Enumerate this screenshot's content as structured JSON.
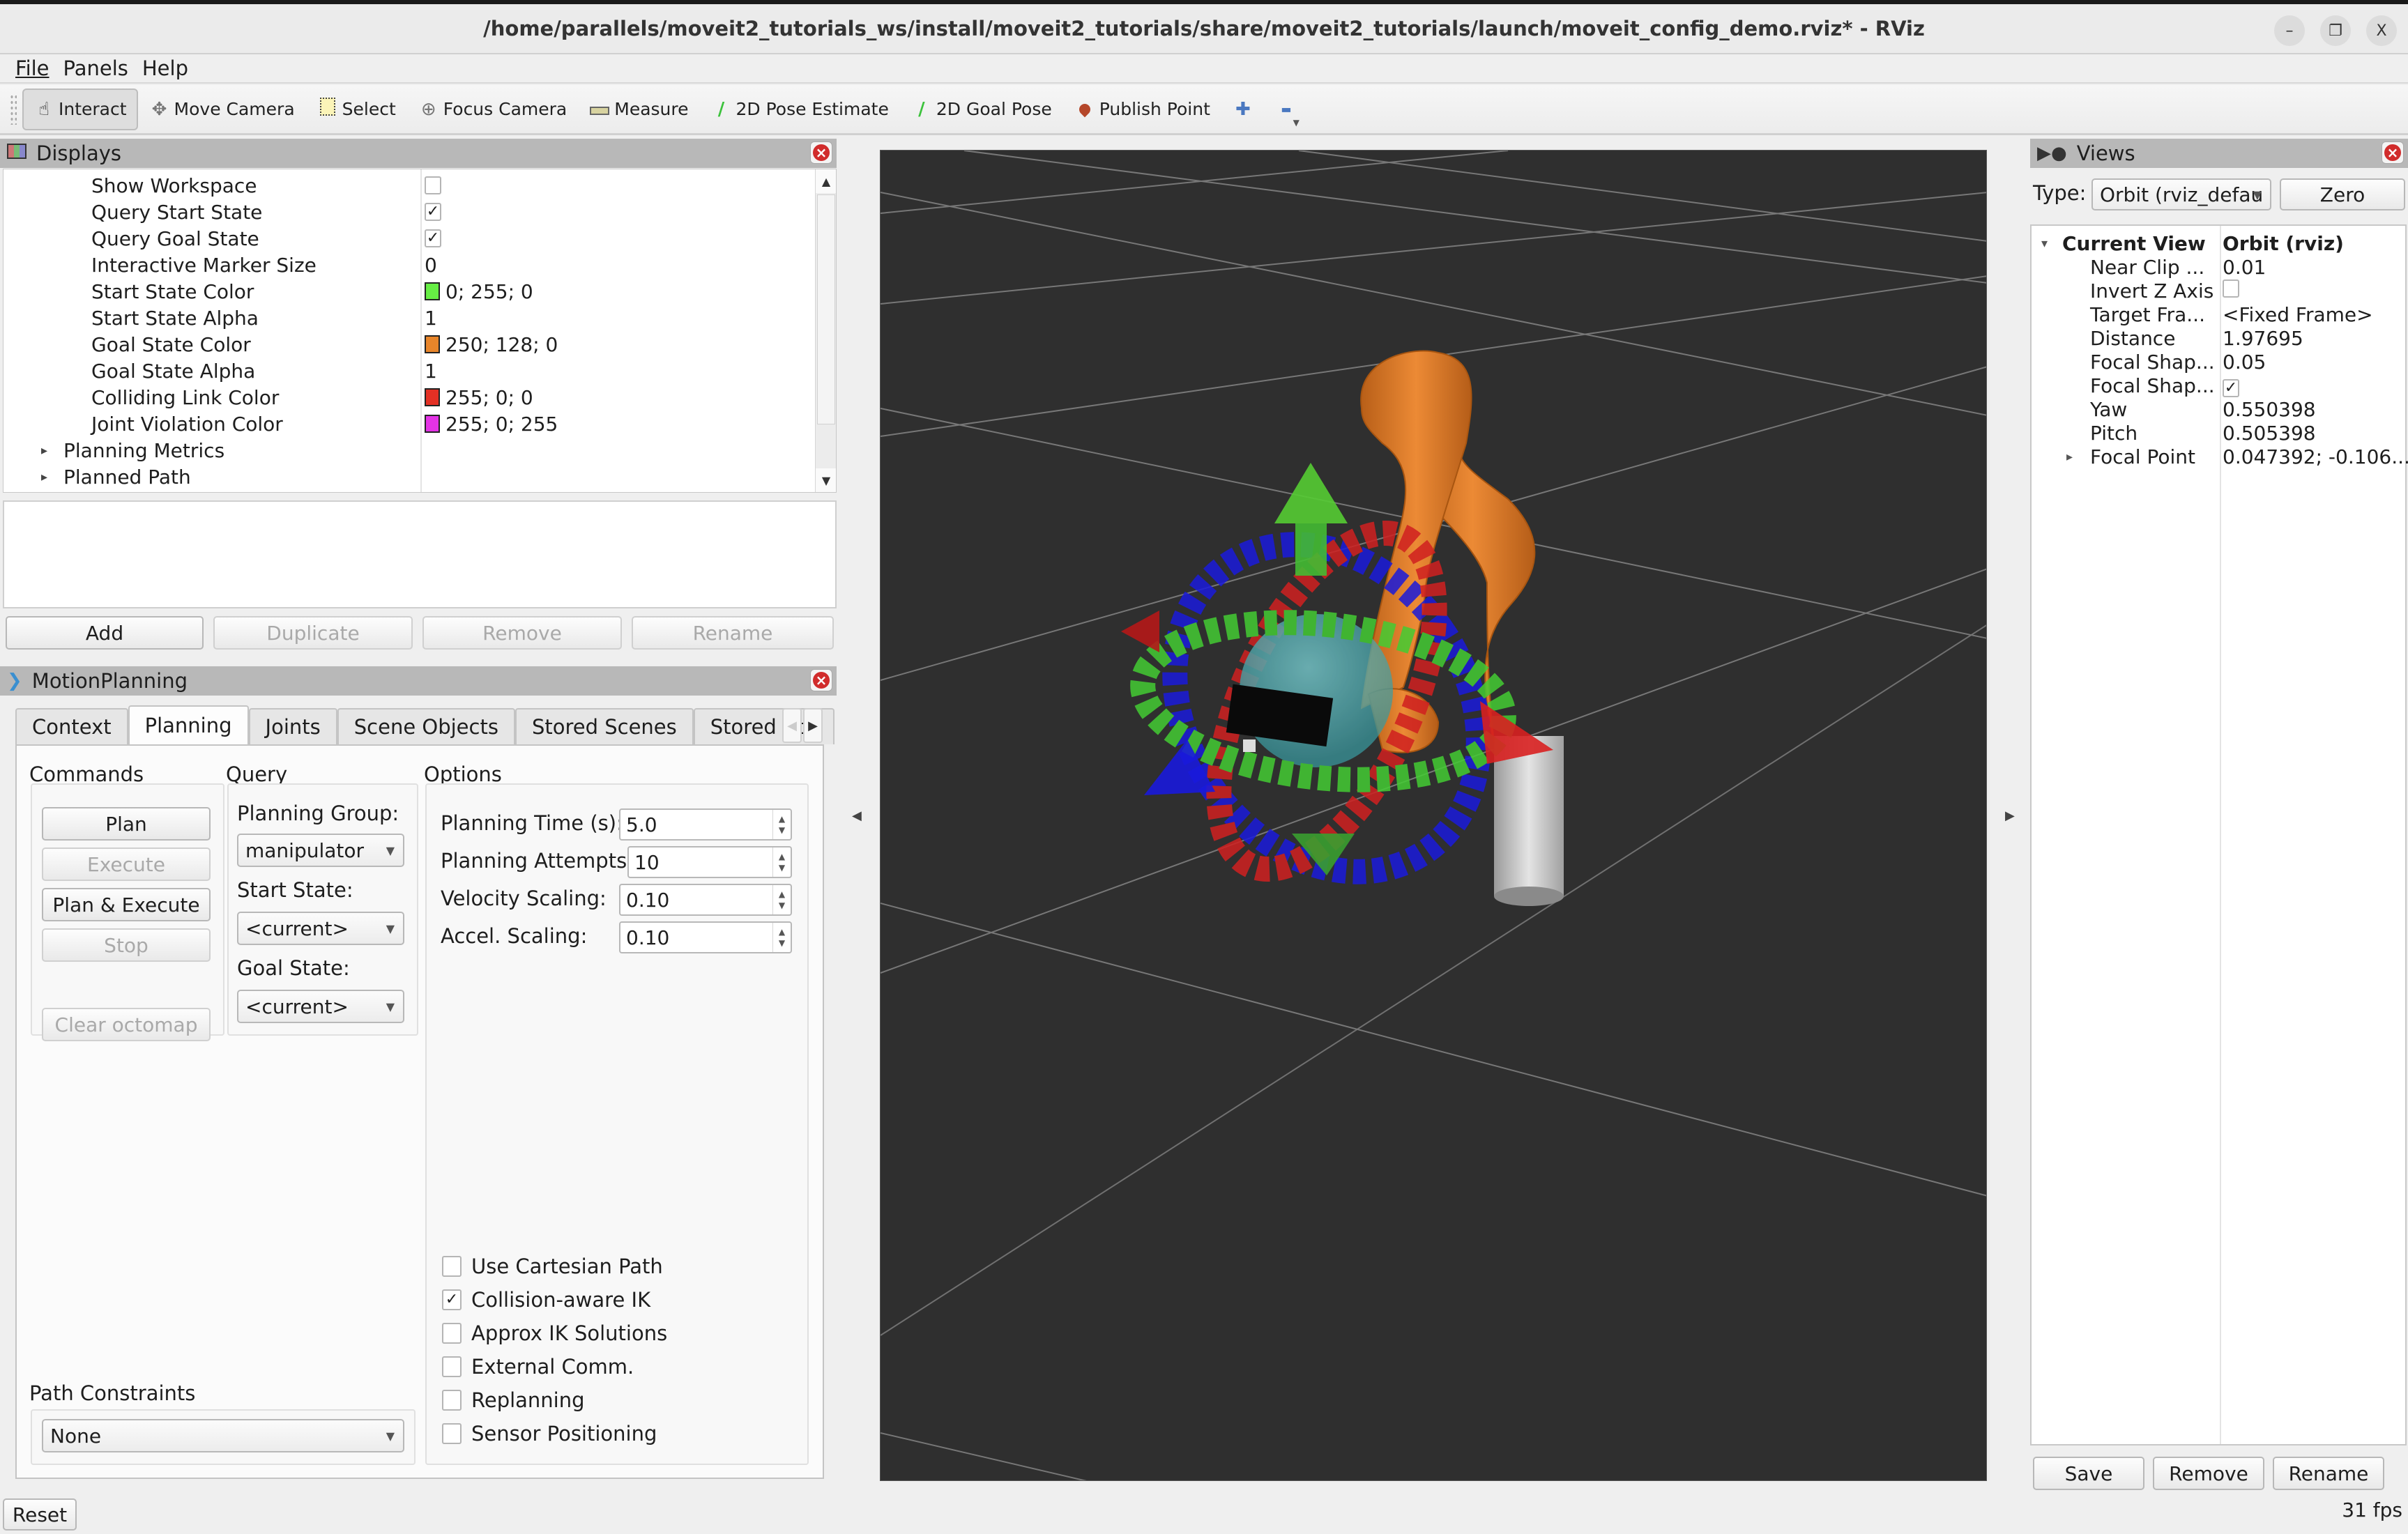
{
  "window": {
    "title": "/home/parallels/moveit2_tutorials_ws/install/moveit2_tutorials/share/moveit2_tutorials/launch/moveit_config_demo.rviz* - RViz",
    "buttons": {
      "minimize": "–",
      "maximize": "❐",
      "close": "X"
    }
  },
  "menu": [
    "File",
    "Panels",
    "Help"
  ],
  "toolbar": {
    "tools": [
      {
        "label": "Interact",
        "icon": "hand-pointer-icon",
        "glyph": "☝",
        "active": true
      },
      {
        "label": "Move Camera",
        "icon": "move-camera-icon",
        "glyph": "✥",
        "active": false
      },
      {
        "label": "Select",
        "icon": "select-icon",
        "glyph": "▭",
        "active": false
      },
      {
        "label": "Focus Camera",
        "icon": "focus-camera-icon",
        "glyph": "⊕",
        "active": false
      },
      {
        "label": "Measure",
        "icon": "ruler-icon",
        "glyph": "▬",
        "active": false
      },
      {
        "label": "2D Pose Estimate",
        "icon": "pose-estimate-arrow-icon",
        "glyph": "∕",
        "active": false
      },
      {
        "label": "2D Goal Pose",
        "icon": "goal-pose-arrow-icon",
        "glyph": "∕",
        "active": false
      },
      {
        "label": "Publish Point",
        "icon": "map-pin-icon",
        "glyph": "📍",
        "active": false
      }
    ],
    "add_tool_glyph": "✚",
    "remove_tool_glyph": "▬"
  },
  "displays": {
    "title": "Displays",
    "rows": [
      {
        "name": "Show Workspace",
        "type": "checkbox",
        "checked": false
      },
      {
        "name": "Query Start State",
        "type": "checkbox",
        "checked": true
      },
      {
        "name": "Query Goal State",
        "type": "checkbox",
        "checked": true
      },
      {
        "name": "Interactive Marker Size",
        "type": "text",
        "value": "0"
      },
      {
        "name": "Start State Color",
        "type": "color",
        "value": "0; 255; 0",
        "swatch": "#66ee44"
      },
      {
        "name": "Start State Alpha",
        "type": "text",
        "value": "1"
      },
      {
        "name": "Goal State Color",
        "type": "color",
        "value": "250; 128; 0",
        "swatch": "#e8852a"
      },
      {
        "name": "Goal State Alpha",
        "type": "text",
        "value": "1"
      },
      {
        "name": "Colliding Link Color",
        "type": "color",
        "value": "255; 0; 0",
        "swatch": "#e33024"
      },
      {
        "name": "Joint Violation Color",
        "type": "color",
        "value": "255; 0; 255",
        "swatch": "#e433e6"
      },
      {
        "name": "Planning Metrics",
        "type": "group",
        "value": ""
      },
      {
        "name": "Planned Path",
        "type": "group",
        "value": ""
      }
    ],
    "buttons": {
      "add": "Add",
      "duplicate": "Duplicate",
      "remove": "Remove",
      "rename": "Rename"
    }
  },
  "motion_planning": {
    "title": "MotionPlanning",
    "tabs": [
      "Context",
      "Planning",
      "Joints",
      "Scene Objects",
      "Stored Scenes",
      "Stored Sta"
    ],
    "active_tab": "Planning",
    "commands": {
      "label": "Commands",
      "plan": "Plan",
      "execute": "Execute",
      "plan_execute": "Plan & Execute",
      "stop": "Stop",
      "clear_octomap": "Clear octomap"
    },
    "query": {
      "label": "Query",
      "planning_group_label": "Planning Group:",
      "planning_group": "manipulator",
      "start_state_label": "Start State:",
      "start_state": "<current>",
      "goal_state_label": "Goal State:",
      "goal_state": "<current>"
    },
    "options": {
      "label": "Options",
      "planning_time_label": "Planning Time (s):",
      "planning_time": "5.0",
      "planning_attempts_label": "Planning Attempts:",
      "planning_attempts": "10",
      "velocity_scaling_label": "Velocity Scaling:",
      "velocity_scaling": "0.10",
      "accel_scaling_label": "Accel. Scaling:",
      "accel_scaling": "0.10",
      "checkboxes": [
        {
          "label": "Use Cartesian Path",
          "checked": false
        },
        {
          "label": "Collision-aware IK",
          "checked": true
        },
        {
          "label": "Approx IK Solutions",
          "checked": false
        },
        {
          "label": "External Comm.",
          "checked": false
        },
        {
          "label": "Replanning",
          "checked": false
        },
        {
          "label": "Sensor Positioning",
          "checked": false
        }
      ]
    },
    "path_constraints": {
      "label": "Path Constraints",
      "value": "None"
    },
    "reset": "Reset"
  },
  "views": {
    "title": "Views",
    "type_label": "Type:",
    "type_value": "Orbit (rviz_defau",
    "zero": "Zero",
    "rows": [
      {
        "name": "Current View",
        "value": "Orbit (rviz)",
        "bold": true,
        "expander": "▾"
      },
      {
        "name": "Near Clip ...",
        "value": "0.01"
      },
      {
        "name": "Invert Z Axis",
        "type": "checkbox",
        "checked": false
      },
      {
        "name": "Target Fra...",
        "value": "<Fixed Frame>"
      },
      {
        "name": "Distance",
        "value": "1.97695"
      },
      {
        "name": "Focal Shap...",
        "value": "0.05"
      },
      {
        "name": "Focal Shap...",
        "type": "checkbox",
        "checked": true
      },
      {
        "name": "Yaw",
        "value": "0.550398"
      },
      {
        "name": "Pitch",
        "value": "0.505398"
      },
      {
        "name": "Focal Point",
        "value": "0.047392; -0.106...",
        "expander": "▸"
      }
    ],
    "buttons": {
      "save": "Save",
      "remove": "Remove",
      "rename": "Rename"
    }
  },
  "status": {
    "fps": "31 fps"
  },
  "viewport": {
    "background": "#2f2f2f",
    "grid_color": "#8a8a8a",
    "robot_color": "#e8852a",
    "base_color": "#c8c8c8",
    "marker_colors": {
      "x": "#dd2222",
      "y": "#44cc33",
      "z": "#1a1adb",
      "sphere": "#5fc8cc"
    }
  }
}
